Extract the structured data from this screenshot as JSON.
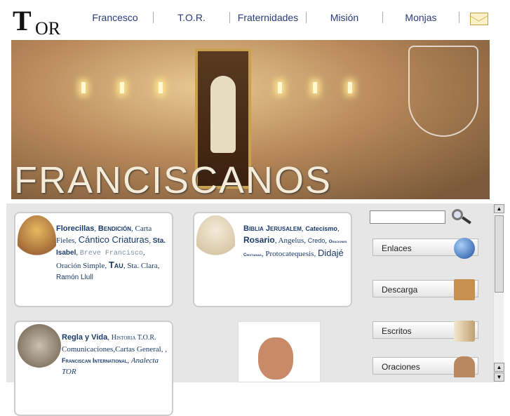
{
  "logo": {
    "text": "TOR"
  },
  "nav": [
    "Francesco",
    "T.O.R.",
    "Fraternidades",
    "Misión",
    "Monjas"
  ],
  "banner": {
    "title": "FRANCISCANOS"
  },
  "cards": {
    "c1": {
      "a": "Florecillas",
      "b": "Bendición",
      "c": "Carta Fieles",
      "d": "Cántico Criaturas",
      "e": "Sta. Isabel",
      "f": "Breve Francisco",
      "g": "Oración Simple",
      "h": "Tau",
      "i": "Sta. Clara",
      "j": "Ramón Llull"
    },
    "c2": {
      "a": "Biblia Jerusalem",
      "b": "Catecismo",
      "c": "Rosario",
      "d": "Angelus",
      "e": "Credo",
      "f": "Oraciones Cristianas",
      "g": "Protocatequesis",
      "h": "Didajé"
    },
    "c3": {
      "a": "Regla y Vida",
      "b": "Historia T.O.R.",
      "c": "Comunicaciones,Cartas General, ,",
      "d": "Franciscan International",
      "e": "Analecta TOR"
    }
  },
  "sidebar": {
    "search_placeholder": "",
    "buttons": [
      "Enlaces",
      "Descarga",
      "Escritos",
      "Oraciones"
    ]
  }
}
